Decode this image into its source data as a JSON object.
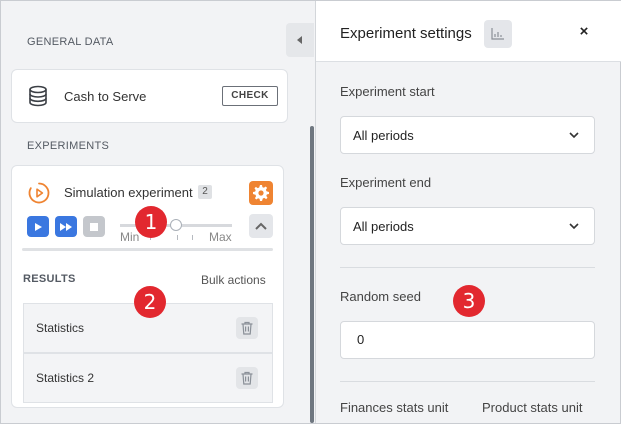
{
  "left": {
    "general_data_title": "GENERAL DATA",
    "cash": {
      "label": "Cash to Serve",
      "button": "CHECK"
    },
    "experiments_title": "EXPERIMENTS",
    "experiment": {
      "label": "Simulation experiment",
      "count": "2",
      "slider_min": "Min",
      "slider_max": "Max",
      "slider_position": 0.5
    },
    "results": {
      "title": "RESULTS",
      "bulk_actions": "Bulk actions",
      "items": [
        {
          "label": "Statistics"
        },
        {
          "label": "Statistics 2"
        }
      ]
    }
  },
  "right": {
    "title": "Experiment settings",
    "close": "×",
    "experiment_start": {
      "label": "Experiment start",
      "value": "All periods"
    },
    "experiment_end": {
      "label": "Experiment end",
      "value": "All periods"
    },
    "random_seed": {
      "label": "Random seed",
      "value": "0"
    },
    "finances_stats_unit": "Finances stats unit",
    "product_stats_unit": "Product stats unit"
  },
  "callouts": [
    "1",
    "2",
    "3"
  ],
  "colors": {
    "accent": "#3a77e0",
    "gear": "#ef8432",
    "callout": "#e2282f"
  },
  "icons": [
    "database-icon",
    "play-circle-icon",
    "gear-icon",
    "play-icon",
    "fast-forward-icon",
    "stop-icon",
    "chevron-up-icon",
    "trash-icon",
    "chevron-left-icon",
    "chart-icon",
    "close-icon",
    "chevron-down-icon"
  ]
}
